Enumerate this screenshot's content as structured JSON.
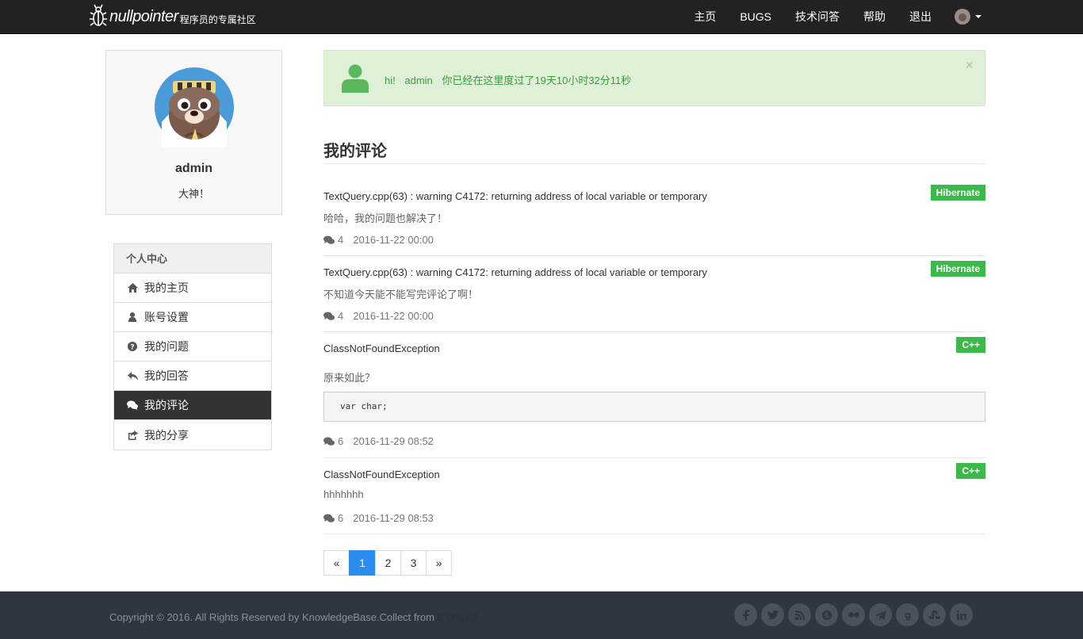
{
  "navbar": {
    "brand_main": "nullpointer",
    "brand_sub": "程序员的专属社区",
    "links": [
      "主页",
      "BUGS",
      "技术问答",
      "帮助",
      "退出"
    ]
  },
  "profile": {
    "name": "admin",
    "motto": "大神！"
  },
  "menu": {
    "header": "个人中心",
    "items": [
      {
        "label": "我的主页",
        "icon": "home-icon"
      },
      {
        "label": "账号设置",
        "icon": "user-icon"
      },
      {
        "label": "我的问题",
        "icon": "question-icon"
      },
      {
        "label": "我的回答",
        "icon": "reply-icon"
      },
      {
        "label": "我的评论",
        "icon": "comments-icon"
      },
      {
        "label": "我的分享",
        "icon": "share-icon"
      }
    ],
    "active_index": 4
  },
  "alert": {
    "greeting": "hi!",
    "user": "admin",
    "message": "你已经在这里度过了19天10小时32分11秒",
    "close": "×"
  },
  "section": {
    "title": "我的评论"
  },
  "comments": [
    {
      "title": "TextQuery.cpp(63) : warning C4172: returning address of local variable or temporary",
      "body": "哈哈，我的问题也解决了！",
      "tag": "Hibernate",
      "count": "4",
      "date": "2016-11-22 00:00"
    },
    {
      "title": "TextQuery.cpp(63) : warning C4172: returning address of local variable or temporary",
      "body": "不知道今天能不能写完评论了啊！",
      "tag": "Hibernate",
      "count": "4",
      "date": "2016-11-22 00:00"
    },
    {
      "title": "ClassNotFoundException",
      "body": "原来如此？",
      "code": "var char;",
      "tag": "C++",
      "count": "6",
      "date": "2016-11-29 08:52"
    },
    {
      "title": "ClassNotFoundException",
      "body": "hhhhhhh",
      "tag": "C++",
      "count": "6",
      "date": "2016-11-29 08:53"
    }
  ],
  "pagination": {
    "prev": "«",
    "pages": [
      "1",
      "2",
      "3"
    ],
    "current": "1",
    "next": "»"
  },
  "footer": {
    "copyright": "Copyright © 2016. All Rights Reserved by KnowledgeBase.Collect from",
    "org": "EXP小组",
    "socials": [
      "facebook-icon",
      "twitter-icon",
      "rss-icon",
      "skype-icon",
      "flickr-icon",
      "paper-plane-icon",
      "google-icon",
      "stumbleupon-icon",
      "linkedin-icon"
    ]
  },
  "colors": {
    "navbar_bg": "#222222",
    "alert_bg": "#dff0d8",
    "alert_text": "#3c9b3c",
    "badge": "#3cb94b",
    "menu_active": "#333333",
    "pager_active": "#2d8cf0",
    "footer_bg": "#303640"
  }
}
